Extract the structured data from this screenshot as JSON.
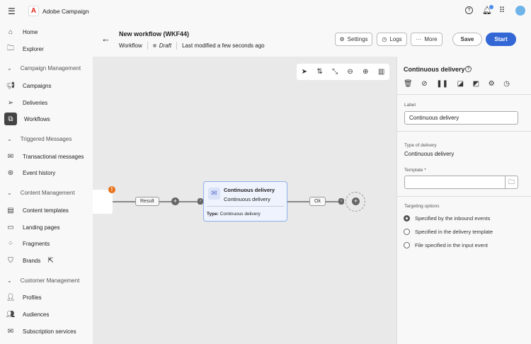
{
  "app": {
    "title": "Adobe Campaign"
  },
  "sidebar": {
    "home": "Home",
    "explorer": "Explorer",
    "campaign_mgmt": "Campaign Management",
    "campaigns": "Campaigns",
    "deliveries": "Deliveries",
    "workflows": "Workflows",
    "triggered": "Triggered Messages",
    "transactional": "Transactional messages",
    "event_history": "Event history",
    "content_mgmt": "Content Management",
    "content_templates": "Content templates",
    "landing_pages": "Landing pages",
    "fragments": "Fragments",
    "brands": "Brands",
    "customer_mgmt": "Customer Management",
    "profiles": "Profiles",
    "audiences": "Audiences",
    "subscription": "Subscription services"
  },
  "header": {
    "title": "New workflow (WKF44)",
    "type": "Workflow",
    "status": "Draft",
    "modified": "Last modified a few seconds ago",
    "settings": "Settings",
    "logs": "Logs",
    "more": "More",
    "save": "Save",
    "start": "Start"
  },
  "canvas": {
    "result_tag": "Result",
    "ok_tag": "Ok",
    "node": {
      "title": "Continuous delivery",
      "subtitle": "Continuous delivery",
      "type_label": "Type:",
      "type_value": "Continuous delivery"
    }
  },
  "panel": {
    "title": "Continuous delivery",
    "label_label": "Label",
    "label_value": "Continuous delivery",
    "type_label": "Type of delivery",
    "type_value": "Continuous delivery",
    "template_label": "Template",
    "required": "*",
    "targeting_label": "Targeting options",
    "options": [
      "Specified by the inbound events",
      "Specified in the delivery template",
      "File specified in the input event"
    ]
  },
  "colors": {
    "accent": "#3367d6",
    "warning": "#e8711a"
  }
}
